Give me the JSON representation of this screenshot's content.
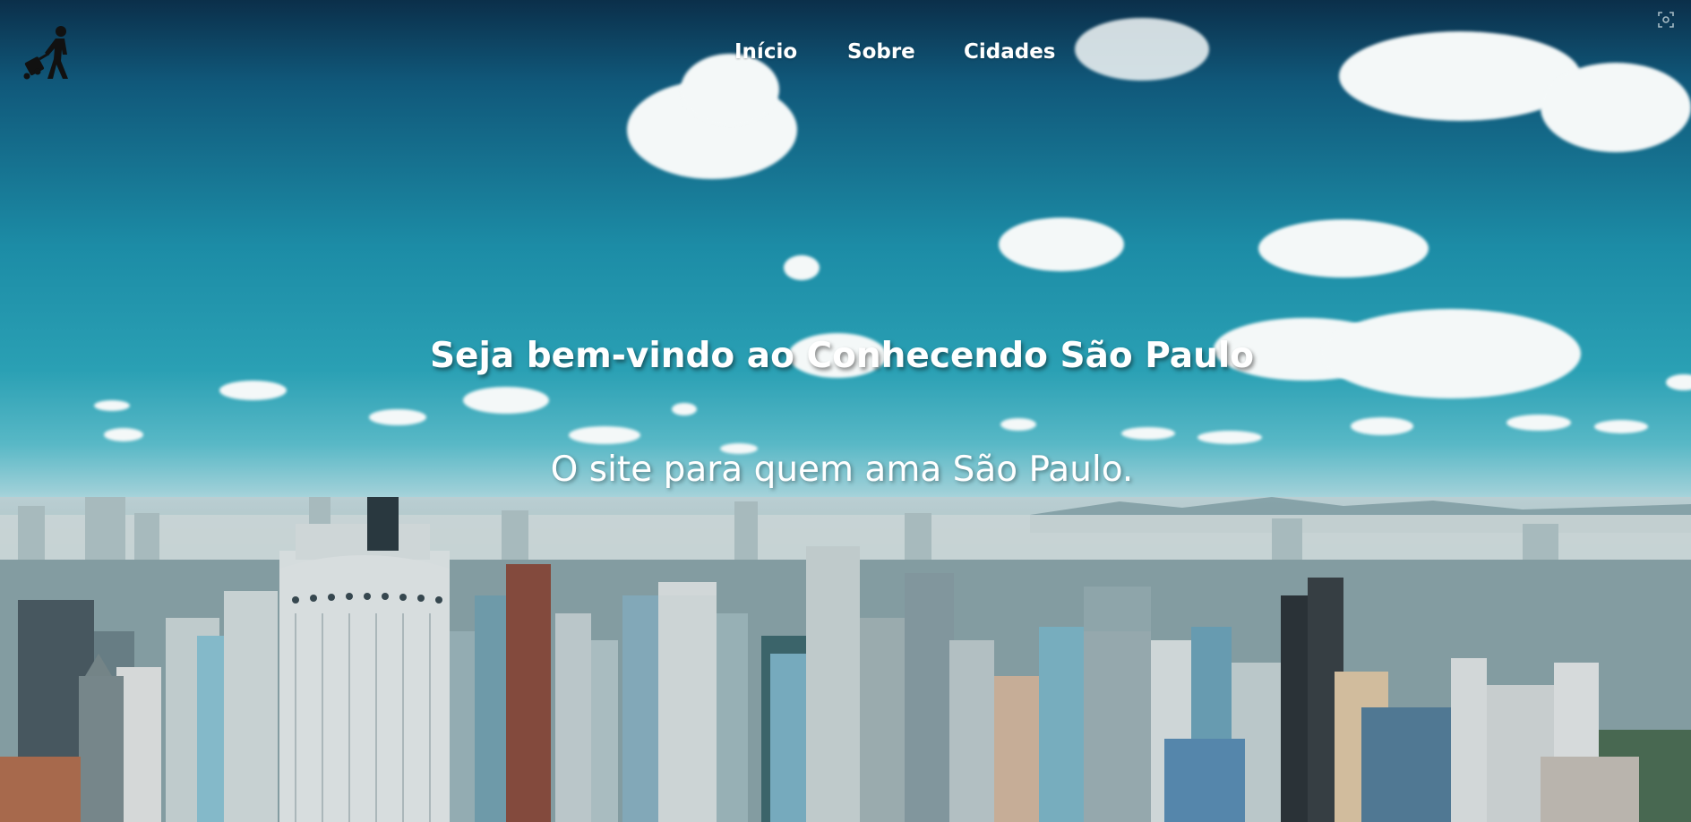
{
  "nav": {
    "items": [
      {
        "label": "Início"
      },
      {
        "label": "Sobre"
      },
      {
        "label": "Cidades"
      }
    ]
  },
  "logo": {
    "icon": "traveler-with-suitcase-icon"
  },
  "hero": {
    "title": "Seja bem-vindo ao Conhecendo São Paulo",
    "subtitle": "O site para quem ama São Paulo."
  },
  "colors": {
    "sky_top": "#0b2f4a",
    "sky_mid": "#1c8ca6",
    "text": "#ffffff"
  }
}
